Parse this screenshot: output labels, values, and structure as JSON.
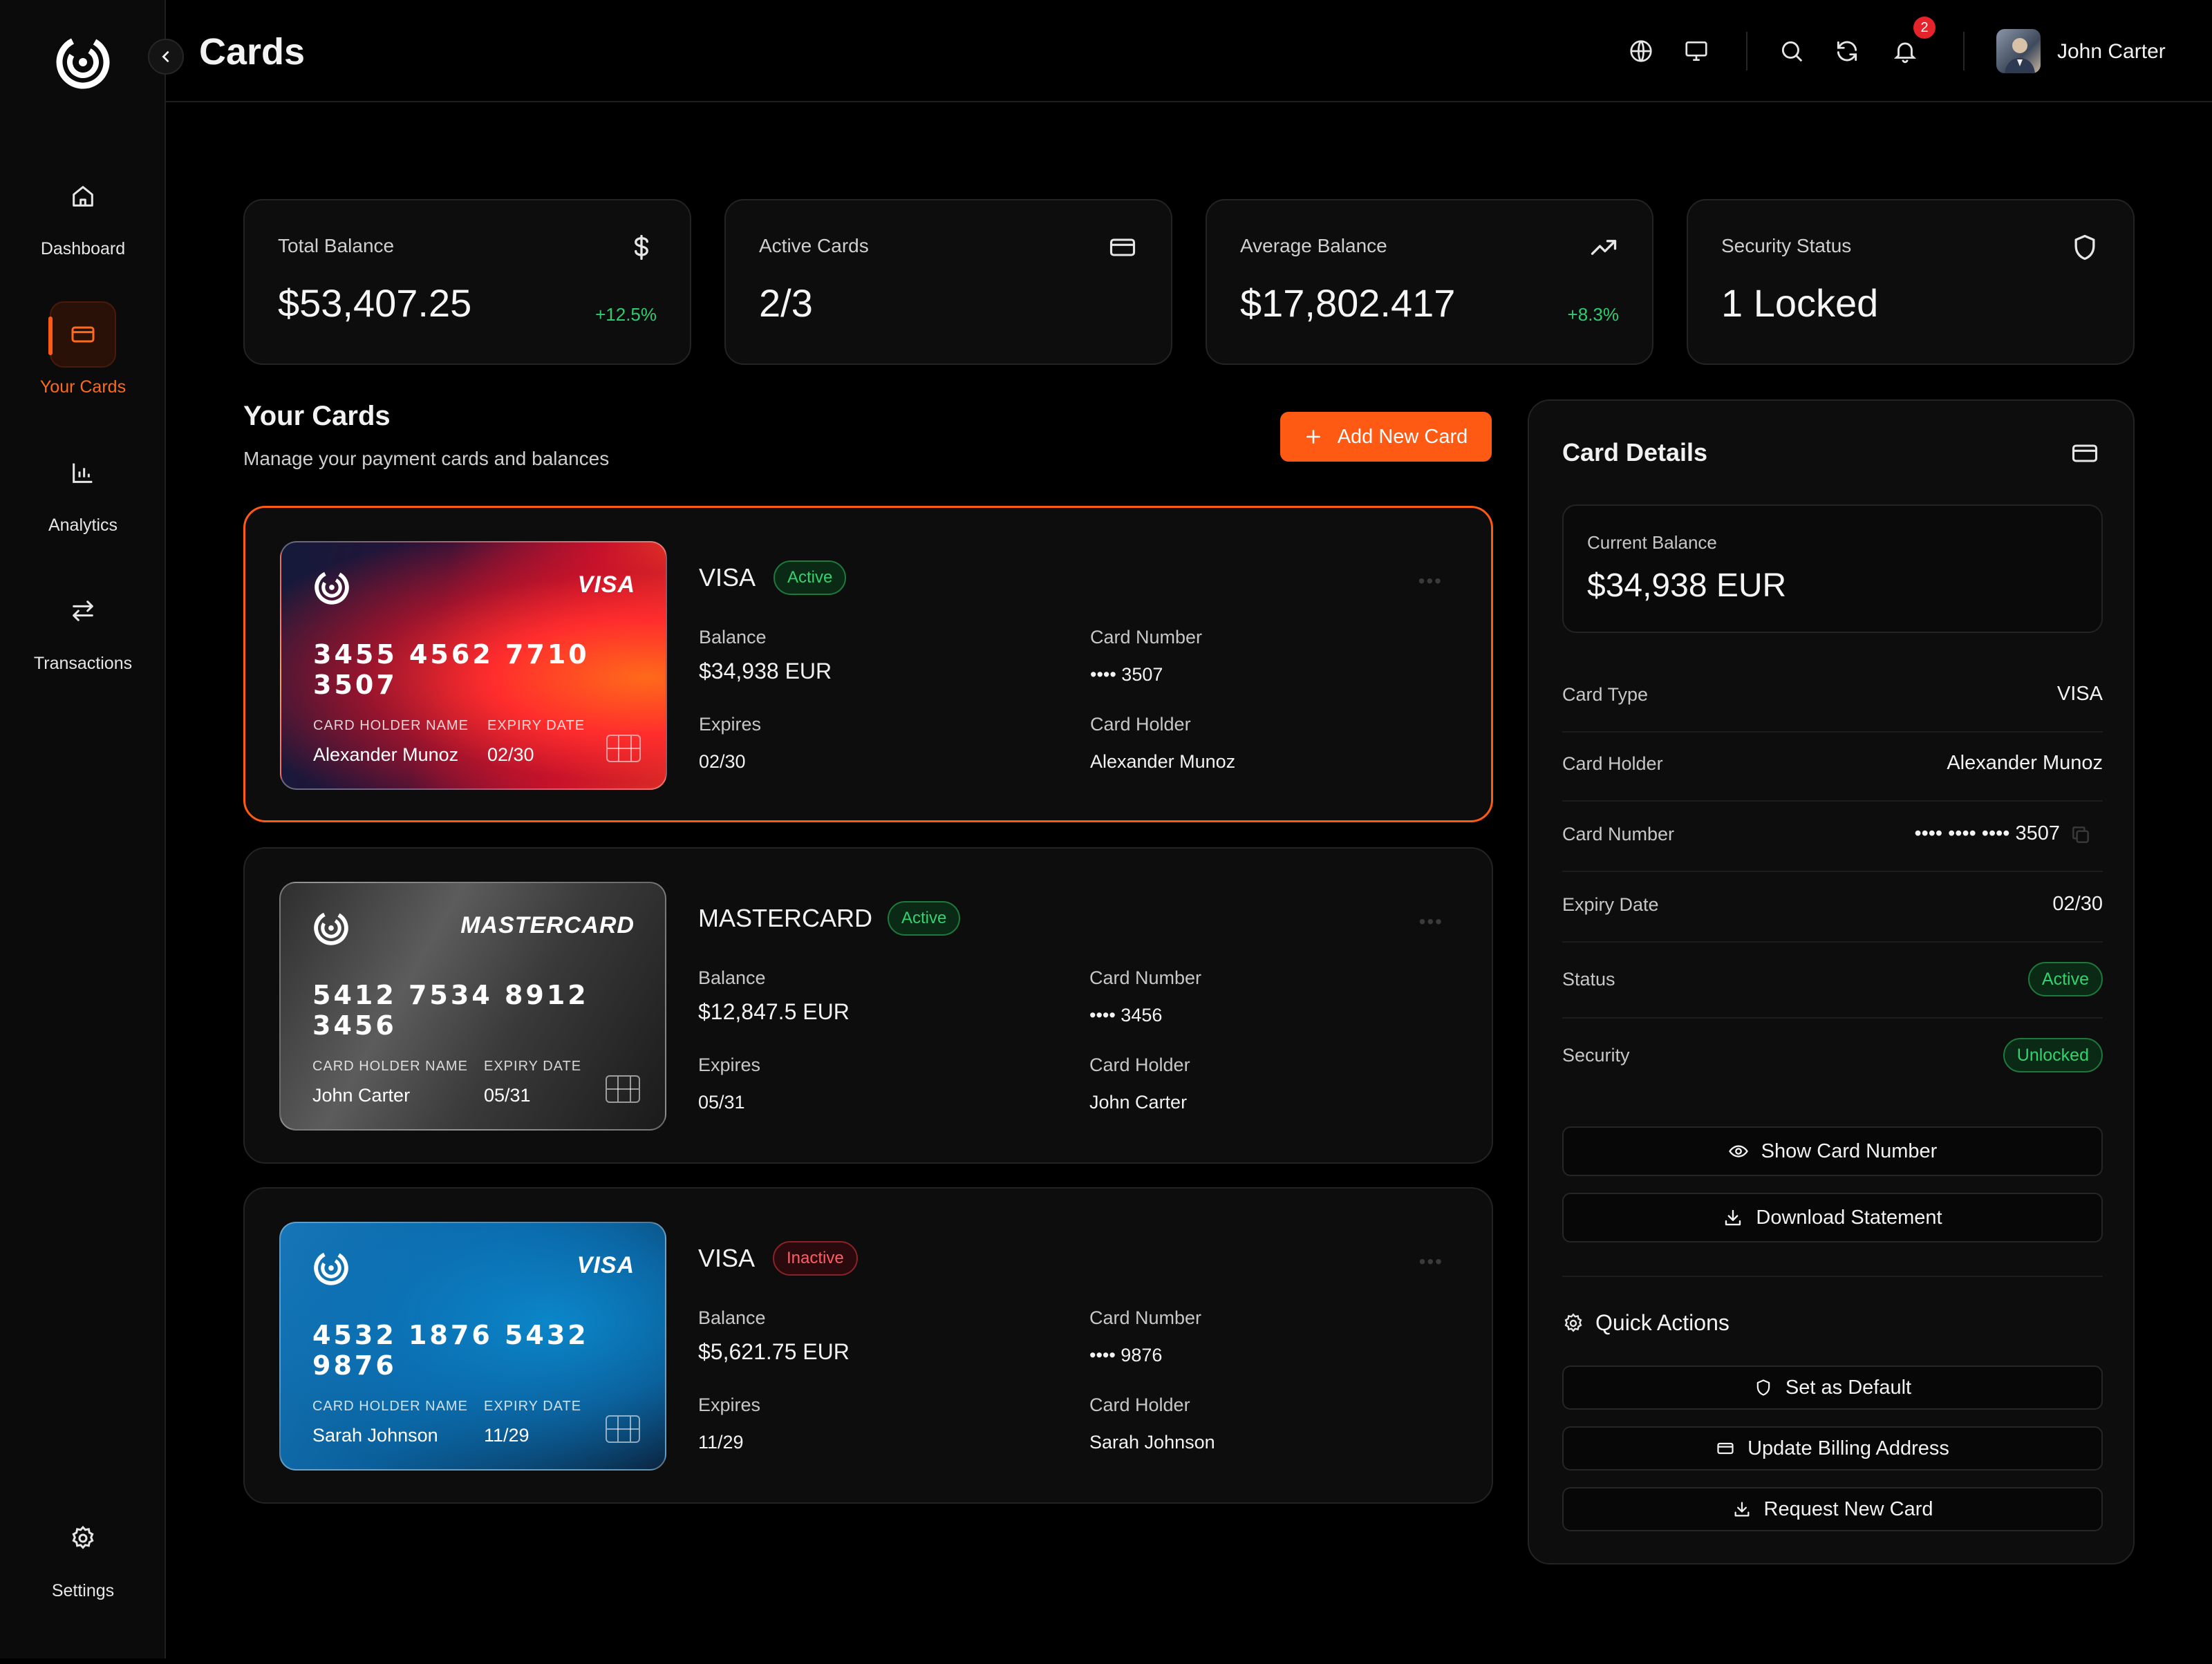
{
  "sidebar": {
    "items": [
      {
        "label": "Dashboard",
        "icon": "home-icon"
      },
      {
        "label": "Your Cards",
        "icon": "credit-card-icon",
        "active": true
      },
      {
        "label": "Analytics",
        "icon": "bar-chart-icon"
      },
      {
        "label": "Transactions",
        "icon": "arrows-swap-icon"
      }
    ],
    "settings_label": "Settings"
  },
  "header": {
    "title": "Cards",
    "notification_count": "2",
    "user_name": "John Carter"
  },
  "stats": [
    {
      "label": "Total Balance",
      "value": "$53,407.25",
      "change": "+12.5%",
      "icon": "dollar-icon"
    },
    {
      "label": "Active Cards",
      "value": "2/3",
      "change": "",
      "icon": "credit-card-icon"
    },
    {
      "label": "Average Balance",
      "value": "$17,802.417",
      "change": "+8.3%",
      "icon": "trending-up-icon"
    },
    {
      "label": "Security Status",
      "value": "1 Locked",
      "change": "",
      "icon": "shield-icon"
    }
  ],
  "cards_section": {
    "title": "Your Cards",
    "subtitle": "Manage your payment cards and balances",
    "add_button": "Add New Card",
    "balance_label": "Balance",
    "number_label": "Card Number",
    "expires_label": "Expires",
    "holder_label": "Card Holder",
    "holder_name_caption": "CARD HOLDER NAME",
    "expiry_caption": "EXPIRY DATE",
    "cards": [
      {
        "brand": "VISA",
        "brand_display": "VISA",
        "status": "Active",
        "number": "3455 4562 7710 3507",
        "holder": "Alexander Munoz",
        "expiry": "02/30",
        "balance": "$34,938 EUR",
        "masked": "•••• 3507",
        "style": "red"
      },
      {
        "brand": "MASTERCARD",
        "brand_display": "MASTERCARD",
        "status": "Active",
        "number": "5412 7534 8912 3456",
        "holder": "John Carter",
        "expiry": "05/31",
        "balance": "$12,847.5 EUR",
        "masked": "•••• 3456",
        "style": "gray"
      },
      {
        "brand": "VISA",
        "brand_display": "VISA",
        "status": "Inactive",
        "number": "4532 1876 5432 9876",
        "holder": "Sarah Johnson",
        "expiry": "11/29",
        "balance": "$5,621.75 EUR",
        "masked": "•••• 9876",
        "style": "blue"
      }
    ]
  },
  "details": {
    "title": "Card Details",
    "current_balance_label": "Current Balance",
    "current_balance": "$34,938 EUR",
    "rows": {
      "type_label": "Card Type",
      "type": "VISA",
      "holder_label": "Card Holder",
      "holder": "Alexander Munoz",
      "number_label": "Card Number",
      "number": "•••• •••• •••• 3507",
      "expiry_label": "Expiry Date",
      "expiry": "02/30",
      "status_label": "Status",
      "status": "Active",
      "security_label": "Security",
      "security": "Unlocked"
    },
    "show_number_button": "Show Card Number",
    "download_button": "Download Statement",
    "quick_actions_title": "Quick Actions",
    "set_default_button": "Set as Default",
    "update_billing_button": "Update Billing Address",
    "request_card_button": "Request New Card"
  },
  "colors": {
    "accent": "#ff5a14",
    "positive": "#2ecc71",
    "danger": "#ff5d66"
  }
}
